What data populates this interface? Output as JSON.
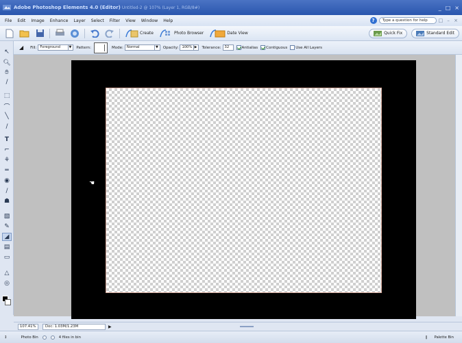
{
  "window": {
    "title": "Adobe Photoshop Elements 4.0 (Editor)",
    "document_info": "Untitled-2 @ 107% (Layer 1, RGB/8#)",
    "controls": [
      "_",
      "□",
      "×"
    ]
  },
  "menu": {
    "items": [
      "File",
      "Edit",
      "Image",
      "Enhance",
      "Layer",
      "Select",
      "Filter",
      "View",
      "Window",
      "Help"
    ],
    "help_placeholder": "Type a question for help",
    "doc_controls": "□ – ×"
  },
  "shortcuts": {
    "create_label": "Create",
    "photo_browser_label": "Photo Browser",
    "date_view_label": "Date View",
    "quick_fix_label": "Quick Fix",
    "standard_edit_label": "Standard Edit"
  },
  "options": {
    "fill_label": "Fill:",
    "fill_value": "Foreground",
    "pattern_label": "Pattern:",
    "mode_label": "Mode:",
    "mode_value": "Normal",
    "opacity_label": "Opacity:",
    "opacity_value": "100%",
    "tolerance_label": "Tolerance:",
    "tolerance_value": "32",
    "antialias_label": "Antialias",
    "contiguous_label": "Contiguous",
    "all_layers_label": "Use All Layers"
  },
  "status": {
    "zoom": "107.41%",
    "doc_size": "Doc: 1.03M/1.23M"
  },
  "bottom": {
    "photo_bin_label": "Photo Bin",
    "files_label": "4 files in bin",
    "palette_bin_label": "Palette Bin"
  },
  "colors": {
    "foreground": "#000000",
    "background": "#ffffff"
  }
}
